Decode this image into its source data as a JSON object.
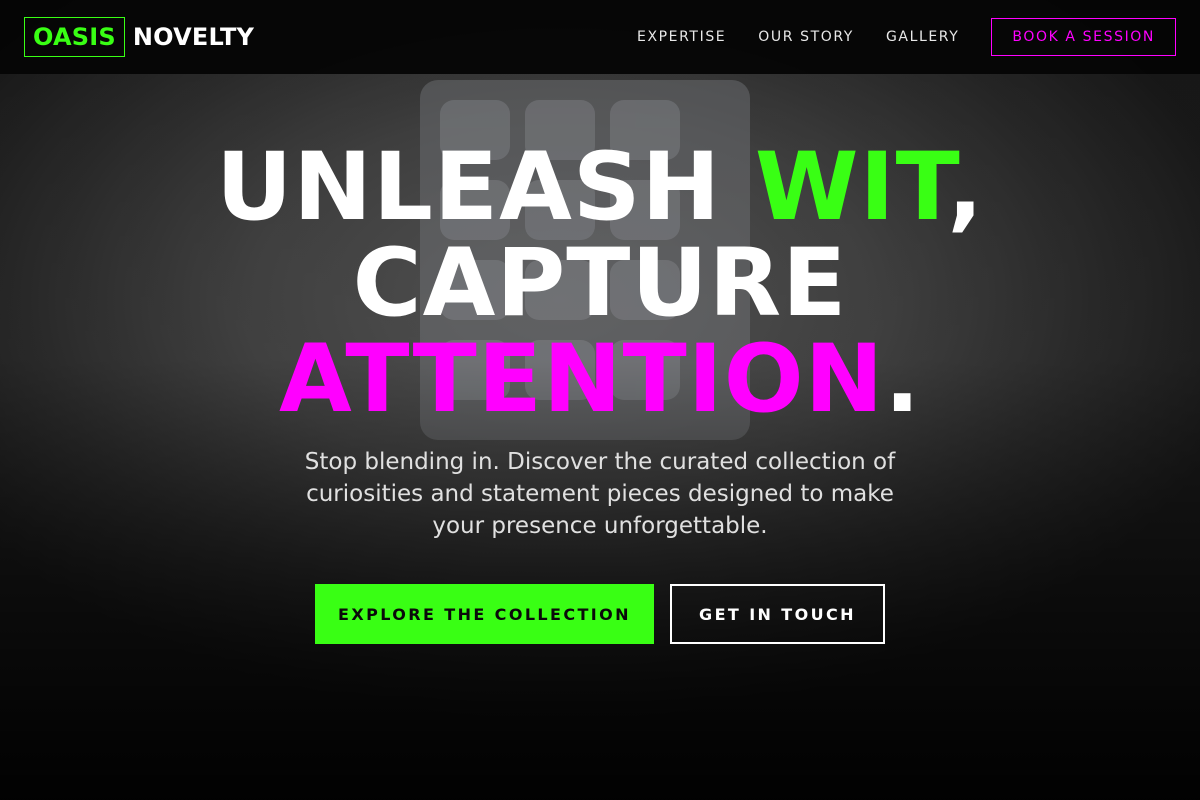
{
  "brand": {
    "boxed": "OASIS",
    "name": "NOVELTY",
    "accent_green": "#39ff14",
    "accent_magenta": "#ff00ff"
  },
  "nav": {
    "items": [
      {
        "label": "EXPERTISE"
      },
      {
        "label": "OUR STORY"
      },
      {
        "label": "GALLERY"
      }
    ],
    "cta_label": "BOOK A SESSION"
  },
  "hero": {
    "headline": {
      "part1": "UNLEASH ",
      "part2": "WIT",
      "part3": ",",
      "part4": "CAPTURE",
      "part5": "ATTENTION",
      "part6": "."
    },
    "subtitle": "Stop blending in. Discover the curated collection of curiosities and statement pieces designed to make your presence unforgettable.",
    "primary_cta": "EXPLORE THE COLLECTION",
    "secondary_cta": "GET IN TOUCH",
    "background_image": "textured-wall-with-mold-tray"
  }
}
